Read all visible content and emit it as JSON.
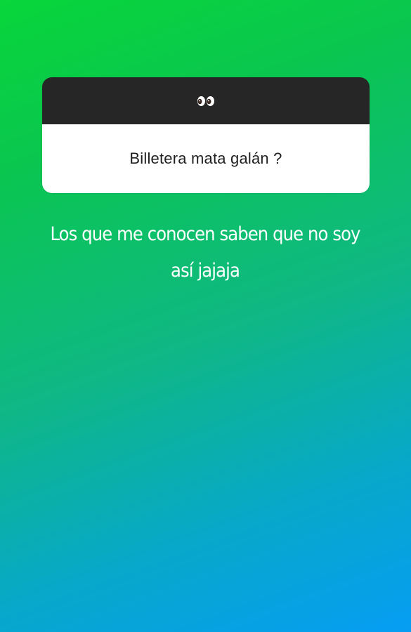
{
  "question_sticker": {
    "header_icon": "eyes-emoji-icon",
    "question": "Billetera mata galán ?"
  },
  "answer": {
    "text": "Los que me conocen saben que no soy así jajaja"
  },
  "colors": {
    "gradient_top": "#08d63a",
    "gradient_bottom": "#069df3",
    "header_background": "#262626",
    "card_background": "#ffffff",
    "answer_text": "#ffffff"
  }
}
